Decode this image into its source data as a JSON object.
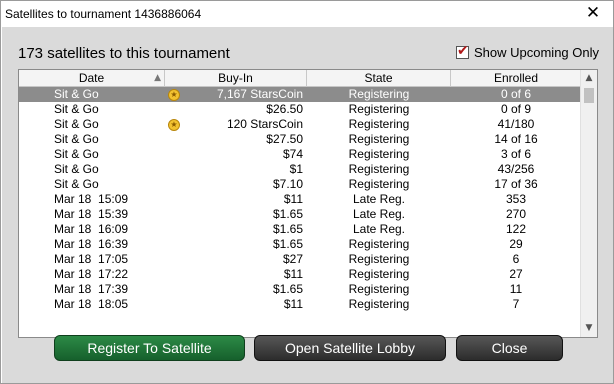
{
  "window": {
    "title": "Satellites to tournament 1436886064",
    "close_symbol": "✕"
  },
  "headline": "173 satellites to this tournament",
  "show_upcoming": {
    "label": "Show Upcoming Only",
    "checked": true
  },
  "columns": [
    "Date",
    "Buy-In",
    "State",
    "Enrolled"
  ],
  "rows": [
    {
      "date": "Sit & Go",
      "coin": true,
      "buyin": "7,167 StarsCoin",
      "state": "Registering",
      "enrolled": "0 of 6",
      "selected": true
    },
    {
      "date": "Sit & Go",
      "coin": false,
      "buyin": "$26.50",
      "state": "Registering",
      "enrolled": "0 of 9"
    },
    {
      "date": "Sit & Go",
      "coin": true,
      "buyin": "120 StarsCoin",
      "state": "Registering",
      "enrolled": "41/180"
    },
    {
      "date": "Sit & Go",
      "coin": false,
      "buyin": "$27.50",
      "state": "Registering",
      "enrolled": "14 of 16"
    },
    {
      "date": "Sit & Go",
      "coin": false,
      "buyin": "$74",
      "state": "Registering",
      "enrolled": "3 of 6"
    },
    {
      "date": "Sit & Go",
      "coin": false,
      "buyin": "$1",
      "state": "Registering",
      "enrolled": "43/256"
    },
    {
      "date": "Sit & Go",
      "coin": false,
      "buyin": "$7.10",
      "state": "Registering",
      "enrolled": "17 of 36"
    },
    {
      "date": "Mar 18  15:09",
      "coin": false,
      "buyin": "$11",
      "state": "Late Reg.",
      "enrolled": "353"
    },
    {
      "date": "Mar 18  15:39",
      "coin": false,
      "buyin": "$1.65",
      "state": "Late Reg.",
      "enrolled": "270"
    },
    {
      "date": "Mar 18  16:09",
      "coin": false,
      "buyin": "$1.65",
      "state": "Late Reg.",
      "enrolled": "122"
    },
    {
      "date": "Mar 18  16:39",
      "coin": false,
      "buyin": "$1.65",
      "state": "Registering",
      "enrolled": "29"
    },
    {
      "date": "Mar 18  17:05",
      "coin": false,
      "buyin": "$27",
      "state": "Registering",
      "enrolled": "6"
    },
    {
      "date": "Mar 18  17:22",
      "coin": false,
      "buyin": "$11",
      "state": "Registering",
      "enrolled": "27"
    },
    {
      "date": "Mar 18  17:39",
      "coin": false,
      "buyin": "$1.65",
      "state": "Registering",
      "enrolled": "11"
    },
    {
      "date": "Mar 18  18:05",
      "coin": false,
      "buyin": "$11",
      "state": "Registering",
      "enrolled": "7"
    }
  ],
  "buttons": {
    "register": "Register To Satellite",
    "lobby": "Open Satellite Lobby",
    "close": "Close"
  }
}
